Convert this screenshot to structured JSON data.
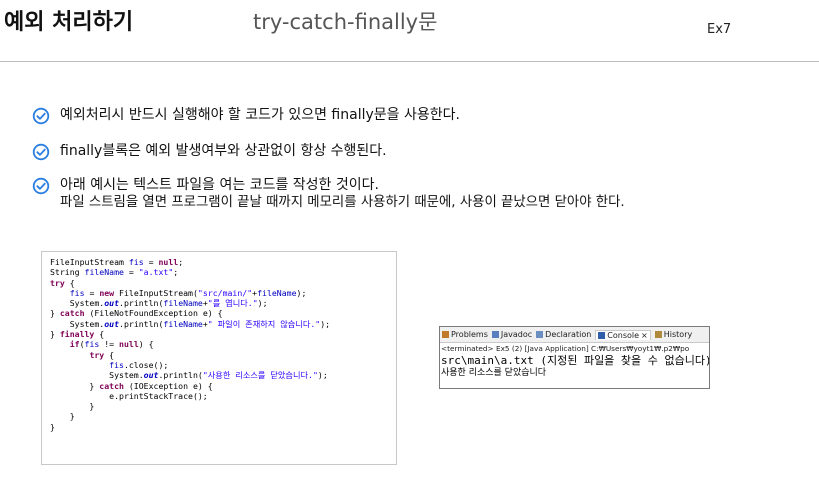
{
  "header": {
    "title": "예외 처리하기",
    "subtitle": "try-catch-finally문",
    "slide_label": "Ex7"
  },
  "bullets": [
    {
      "lines": [
        "예외처리시 반드시 실행해야 할 코드가 있으면 finally문을 사용한다."
      ]
    },
    {
      "lines": [
        "finally블록은 예외 발생여부와 상관없이 항상 수행된다."
      ]
    },
    {
      "lines": [
        "아래 예시는 텍스트 파일을 여는 코드를 작성한 것이다.",
        "파일 스트림을 열면 프로그램이 끝날 때까지 메모리를 사용하기 때문에, 사용이 끝났으면 닫아야 한다."
      ]
    }
  ],
  "code": {
    "lines": [
      [
        {
          "t": "FileInputStream "
        },
        {
          "t": "fis",
          "c": "var"
        },
        {
          "t": " = "
        },
        {
          "t": "null",
          "c": "kw"
        },
        {
          "t": ";"
        }
      ],
      [
        {
          "t": "String "
        },
        {
          "t": "fileName",
          "c": "var"
        },
        {
          "t": " = "
        },
        {
          "t": "\"a.txt\"",
          "c": "str"
        },
        {
          "t": ";"
        }
      ],
      [
        {
          "t": "try",
          "c": "kw"
        },
        {
          "t": " {"
        }
      ],
      [
        {
          "t": "    "
        },
        {
          "t": "fis",
          "c": "var"
        },
        {
          "t": " = "
        },
        {
          "t": "new",
          "c": "kw"
        },
        {
          "t": " FileInputStream("
        },
        {
          "t": "\"src/main/\"",
          "c": "str"
        },
        {
          "t": "+"
        },
        {
          "t": "fileName",
          "c": "var"
        },
        {
          "t": ");"
        }
      ],
      [
        {
          "t": "    System."
        },
        {
          "t": "out",
          "c": "st"
        },
        {
          "t": ".println("
        },
        {
          "t": "fileName",
          "c": "var"
        },
        {
          "t": "+"
        },
        {
          "t": "\"를 엽니다.\"",
          "c": "str"
        },
        {
          "t": ");"
        }
      ],
      [
        {
          "t": "} "
        },
        {
          "t": "catch",
          "c": "kw"
        },
        {
          "t": " (FileNotFoundException e) {"
        }
      ],
      [
        {
          "t": "    System."
        },
        {
          "t": "out",
          "c": "st"
        },
        {
          "t": ".println("
        },
        {
          "t": "fileName",
          "c": "var"
        },
        {
          "t": "+"
        },
        {
          "t": "\" 파일이 존재하지 않습니다.\"",
          "c": "str"
        },
        {
          "t": ");"
        }
      ],
      [
        {
          "t": "} "
        },
        {
          "t": "finally",
          "c": "kw"
        },
        {
          "t": " {"
        }
      ],
      [
        {
          "t": "    "
        },
        {
          "t": "if",
          "c": "kw"
        },
        {
          "t": "("
        },
        {
          "t": "fis",
          "c": "var"
        },
        {
          "t": " != "
        },
        {
          "t": "null",
          "c": "kw"
        },
        {
          "t": ") {"
        }
      ],
      [
        {
          "t": "        "
        },
        {
          "t": "try",
          "c": "kw"
        },
        {
          "t": " {"
        }
      ],
      [
        {
          "t": "            "
        },
        {
          "t": "fis",
          "c": "var"
        },
        {
          "t": ".close();"
        }
      ],
      [
        {
          "t": "            System."
        },
        {
          "t": "out",
          "c": "st"
        },
        {
          "t": ".println("
        },
        {
          "t": "\"사용한 리소스를 닫았습니다.\"",
          "c": "str"
        },
        {
          "t": ");"
        }
      ],
      [
        {
          "t": "        } "
        },
        {
          "t": "catch",
          "c": "kw"
        },
        {
          "t": " (IOException e) {"
        }
      ],
      [
        {
          "t": "            e.printStackTrace();"
        }
      ],
      [
        {
          "t": "        }"
        }
      ],
      [
        {
          "t": "    }"
        }
      ],
      [
        {
          "t": "}"
        }
      ]
    ]
  },
  "console": {
    "tabs": [
      {
        "label": "Problems",
        "icon": "problems-icon",
        "color": "#c07a2a"
      },
      {
        "label": "Javadoc",
        "icon": "javadoc-icon",
        "color": "#5a7fbf"
      },
      {
        "label": "Declaration",
        "icon": "declaration-icon",
        "color": "#6a8fc0"
      },
      {
        "label": "Console",
        "icon": "console-icon",
        "color": "#2f5fa8",
        "active": true,
        "close": "×"
      },
      {
        "label": "History",
        "icon": "history-icon",
        "color": "#b08a3c"
      }
    ],
    "terminated": "<terminated> Ex5 (2) [Java Application] C:₩Users₩yoyt1₩.p2₩po",
    "output": [
      "src\\main\\a.txt (지정된 파일을 찾을 수 없습니다)",
      "사용한 리소스를 닫았습니다"
    ]
  },
  "colors": {
    "check": "#2a7de1",
    "rule": "#bdbdbd",
    "keyword": "#7f0055",
    "string": "#2a00ff",
    "field": "#0000c0"
  }
}
